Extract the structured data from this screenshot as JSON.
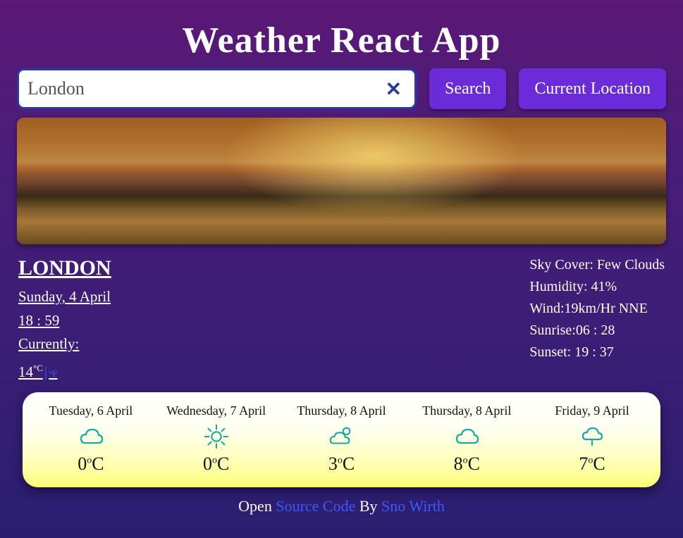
{
  "title": "Weather React App",
  "search": {
    "value": "London",
    "searchButton": "Search",
    "locationButton": "Current Location"
  },
  "current": {
    "city": "LONDON",
    "date": "Sunday, 4 April",
    "time": "18 : 59",
    "currentlyLabel": "Currently:",
    "temp": "14",
    "unitC": "°C",
    "unitF": "°F"
  },
  "details": {
    "skyLabel": "Sky Cover:",
    "skyValue": "Few Clouds",
    "humidityLabel": "Humidity:",
    "humidityValue": "41%",
    "windLabel": "Wind:",
    "windValue": "19km/Hr NNE",
    "sunriseLabel": "Sunrise:",
    "sunriseValue": "06 : 28",
    "sunsetLabel": "Sunset:",
    "sunsetValue": "19 : 37"
  },
  "forecast": [
    {
      "label": "Tuesday, 6 April",
      "icon": "cloud",
      "temp": "0°C"
    },
    {
      "label": "Wednesday, 7 April",
      "icon": "sun",
      "temp": "0°C"
    },
    {
      "label": "Thursday, 8 April",
      "icon": "partly",
      "temp": "3°C"
    },
    {
      "label": "Thursday, 8 April",
      "icon": "cloud",
      "temp": "8°C"
    },
    {
      "label": "Friday, 9 April",
      "icon": "rain",
      "temp": "7°C"
    }
  ],
  "footer": {
    "t1": "Open ",
    "link1": "Source Code",
    "t2": " By ",
    "link2": "Sno Wirth"
  }
}
